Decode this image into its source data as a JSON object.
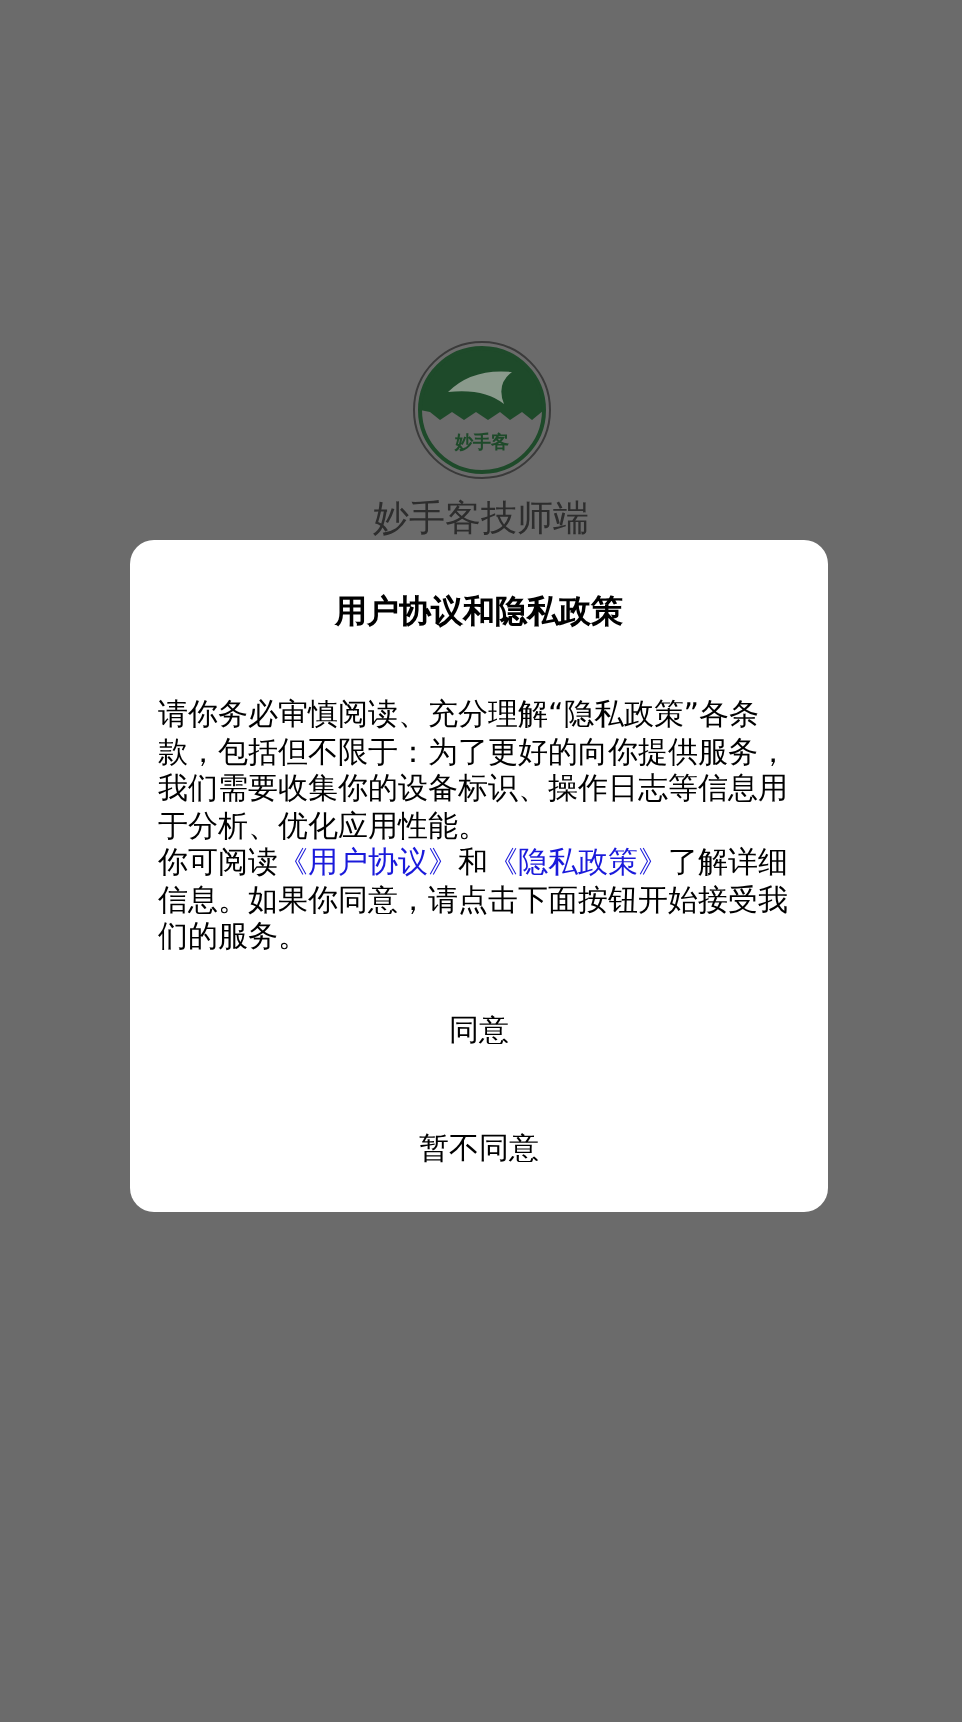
{
  "splash": {
    "logo_text": "妙手客",
    "app_name": "妙手客技师端"
  },
  "dialog": {
    "title": "用户协议和隐私政策",
    "paragraph_1": "请你务必审慎阅读、充分理解“隐私政策”各条款，包括但不限于：为了更好的向你提供服务，我们需要收集你的设备标识、操作日志等信息用于分析、优化应用性能。",
    "paragraph_2": [
      {
        "kind": "text",
        "text": "你可阅读"
      },
      {
        "kind": "link",
        "text": "《用户协议》"
      },
      {
        "kind": "text",
        "text": "和"
      },
      {
        "kind": "link",
        "text": "《隐私政策》"
      },
      {
        "kind": "text",
        "text": "了解详细信息。如果你同意，请点击下面按钮开始接受我们的服务。"
      }
    ],
    "buttons": [
      "同意",
      "暂不同意"
    ]
  }
}
